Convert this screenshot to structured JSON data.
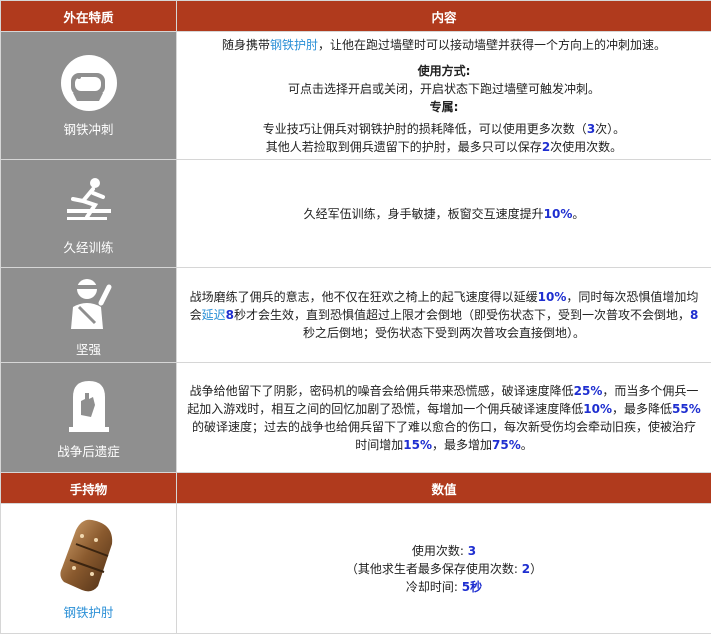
{
  "header": {
    "col1": "外在特质",
    "col2": "内容"
  },
  "traits": [
    {
      "name": "钢铁冲刺",
      "icon": "fist-gauntlet-icon",
      "line1_pre": "随身携带",
      "line1_link": "钢铁护肘",
      "line1_post": "，让他在跑过墙壁时可以接动墙壁并获得一个方向上的冲刺加速。",
      "usage_title": "使用方式:",
      "usage_text": "可点击选择开启或关闭，开启状态下跑过墙壁可触发冲刺。",
      "special_title": "专属:",
      "special_pre": "专业技巧让佣兵对钢铁护肘的损耗降低，可以使用更多次数（",
      "special_num": "3",
      "special_post": "次）。",
      "other_pre": "其他人若捡取到佣兵遗留下的护肘，最多只可以保存",
      "other_num": "2",
      "other_post": "次使用次数。"
    },
    {
      "name": "久经训练",
      "icon": "vaulting-soldier-icon",
      "text_pre": "久经军伍训练，身手敏捷，板窗交互速度提升",
      "text_num": "10%",
      "text_post": "。"
    },
    {
      "name": "坚强",
      "icon": "bandaged-mercenary-icon",
      "t1": "战场磨练了佣兵的意志，他不仅在狂欢之椅上的起飞速度得以延缓",
      "n1": "10%",
      "t2": "，同时每次恐惧值增加均会",
      "link": "延迟",
      "n2": "8",
      "t3": "秒才会生效，直到恐惧值超过上限才会倒地（即受伤状态下，受到一次普攻不会倒地，",
      "n3": "8",
      "t4": "秒之后倒地；受伤状态下受到两次普攻会直接倒地）。"
    },
    {
      "name": "战争后遗症",
      "icon": "tombstone-hand-icon",
      "t1": "战争给他留下了阴影，密码机的噪音会给佣兵带来恐慌感，破译速度降低",
      "n1": "25%",
      "t2": "，而当多个佣兵一起加入游戏时，相互之间的回忆加剧了恐慌，每增加一个佣兵破译速度降低",
      "n2": "10%",
      "t3": "，最多降低",
      "n3": "55%",
      "t4": "的破译速度；过去的战争也给佣兵留下了难以愈合的伤口，每次新受伤均会牵动旧疾，使被治疗时间增加",
      "n4": "15%",
      "t5": "，最多增加",
      "n5": "75%",
      "t6": "。"
    }
  ],
  "item_header": {
    "col1": "手持物",
    "col2": "数值"
  },
  "item": {
    "name": "钢铁护肘",
    "icon": "steel-elbow-guard-icon",
    "uses_label": "使用次数: ",
    "uses_value": "3",
    "others_pre": "（其他求生者最多保存使用次数: ",
    "others_value": "2",
    "others_post": "）",
    "cooldown_label": "冷却时间: ",
    "cooldown_value": "5秒"
  },
  "colors": {
    "header_bg": "#b03a1d",
    "trait_bg": "#8f8f8f",
    "highlight": "#1f2fd0",
    "link": "#2a8fd6"
  }
}
